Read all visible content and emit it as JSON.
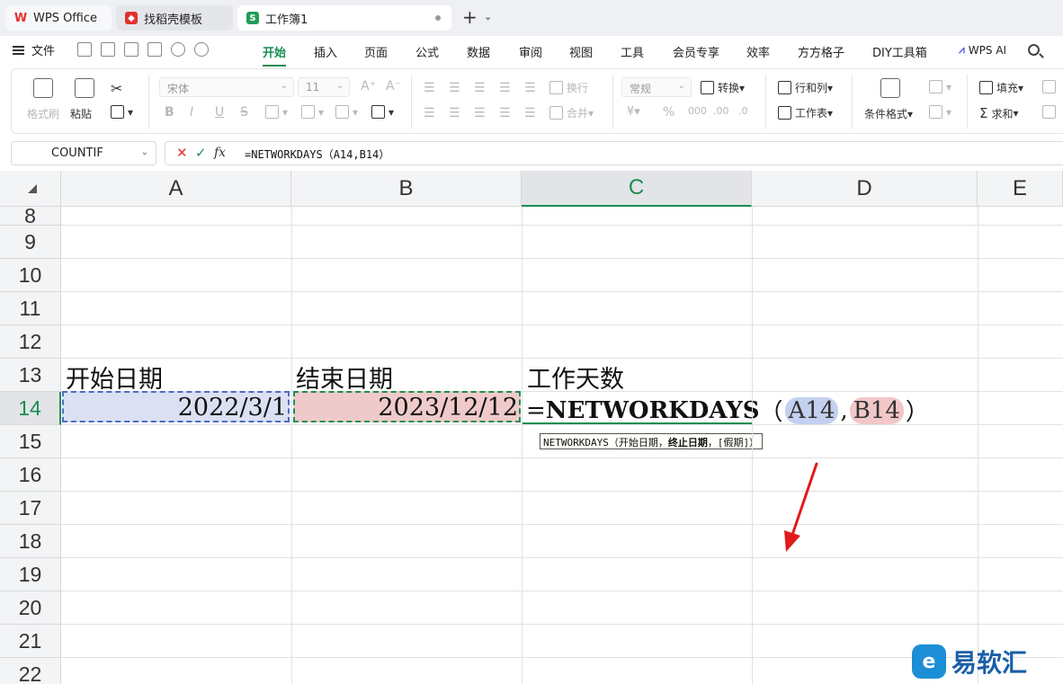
{
  "tabs": {
    "wps": "WPS Office",
    "templates": "找稻壳模板",
    "workbook": "工作簿1",
    "new_tab": "+"
  },
  "menu": {
    "file": "文件",
    "items": [
      "开始",
      "插入",
      "页面",
      "公式",
      "数据",
      "审阅",
      "视图",
      "工具",
      "会员专享",
      "效率",
      "方方格子",
      "DIY工具箱"
    ],
    "active": "开始",
    "ai": "WPS AI"
  },
  "ribbon": {
    "format_painter": "格式刷",
    "paste": "粘贴",
    "font_name": "宋体",
    "font_size": "11",
    "bold": "B",
    "italic": "I",
    "underline": "U",
    "strike": "S",
    "wrap": "换行",
    "merge": "合并",
    "number_format": "常规",
    "convert": "转换",
    "row_col": "行和列",
    "worksheet": "工作表",
    "cond_format": "条件格式",
    "fill": "填充",
    "sum": "求和",
    "percent": "%"
  },
  "formula_bar": {
    "name_box": "COUNTIF",
    "cancel": "✕",
    "confirm": "✓",
    "fx": "fx",
    "formula": "=NETWORKDAYS（A14,B14）"
  },
  "sheet": {
    "columns": [
      "A",
      "B",
      "C",
      "D",
      "E"
    ],
    "selected_column": "C",
    "rows": [
      "8",
      "9",
      "10",
      "11",
      "12",
      "13",
      "14",
      "15",
      "16",
      "17",
      "18",
      "19",
      "20",
      "21",
      "22"
    ],
    "selected_row": "14",
    "cells": {
      "A13": "开始日期",
      "B13": "结束日期",
      "C13": "工作天数",
      "A14": "2022/3/1",
      "B14": "2023/12/12"
    },
    "editing": {
      "prefix": "=",
      "function": "NETWORKDAYS",
      "open": "（",
      "arg1": "A14",
      "comma": ",",
      "arg2": "B14",
      "close": "）"
    },
    "tooltip": {
      "fn": "NETWORKDAYS（开始日期，",
      "current": "终止日期",
      "rest": "，[假期]）"
    }
  },
  "watermark": {
    "mark": "e",
    "text": "易软汇"
  },
  "colors": {
    "accent": "#1a8e52",
    "ref_a": "#c4d0ef",
    "ref_b": "#f2c7c7",
    "arrow": "#e21a1a"
  }
}
